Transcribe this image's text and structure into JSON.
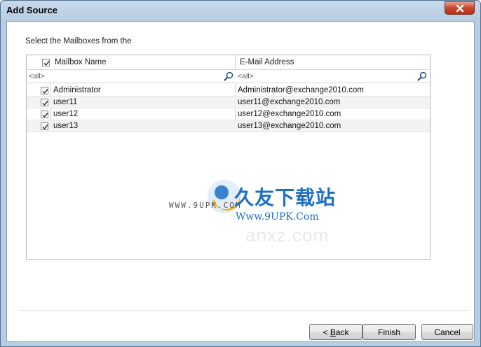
{
  "window": {
    "title": "Add Source",
    "ghost_tabs": [
      "",
      "",
      "",
      ""
    ]
  },
  "prompt": "Select the Mailboxes from the",
  "grid": {
    "columns": [
      {
        "label": "Mailbox Name",
        "filter": "<all>"
      },
      {
        "label": "E-Mail Address",
        "filter": "<all>"
      }
    ],
    "header_checked": true,
    "rows": [
      {
        "name": "Administrator",
        "email": "Administrator@exchange2010.com",
        "checked": true
      },
      {
        "name": "user11",
        "email": "user11@exchange2010.com",
        "checked": true
      },
      {
        "name": "user12",
        "email": "user12@exchange2010.com",
        "checked": true
      },
      {
        "name": "user13",
        "email": "user13@exchange2010.com",
        "checked": true
      }
    ]
  },
  "watermark": {
    "small": "WWW.9UPK.COM",
    "chinese": "久友下载站",
    "url": "Www.9UPK.Com",
    "faint": "anxz.com"
  },
  "buttons": {
    "back_prefix": "< ",
    "back_mnemonic": "B",
    "back_rest": "ack",
    "finish": "Finish",
    "cancel": "Cancel"
  },
  "colors": {
    "titlebar": "#b9cde2",
    "close": "#c9452b",
    "watermark_blue": "#1d6fc4"
  }
}
